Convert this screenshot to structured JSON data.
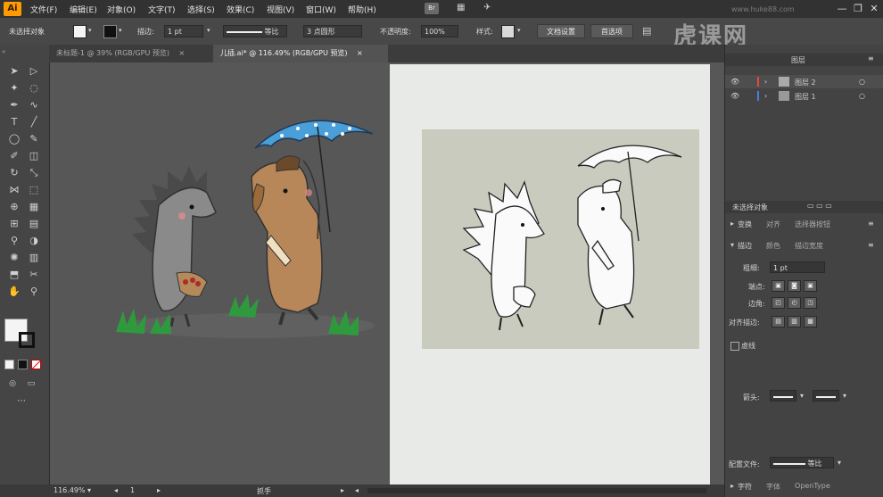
{
  "app": {
    "logo": "Ai"
  },
  "menu": [
    "文件(F)",
    "编辑(E)",
    "对象(O)",
    "文字(T)",
    "选择(S)",
    "效果(C)",
    "视图(V)",
    "窗口(W)",
    "帮助(H)"
  ],
  "window_controls": {
    "minimize": "—",
    "restore": "❐",
    "close": "✕"
  },
  "control_bar": {
    "selection": "未选择对象",
    "stroke_label": "描边:",
    "stroke_value": "1 pt",
    "stroke_style": "等比",
    "brush": "3 点圆形",
    "opacity_label": "不透明度:",
    "opacity_value": "100%",
    "style_label": "样式:",
    "doc_settings": "文档设置",
    "preferences": "首选项"
  },
  "tabs": [
    {
      "label": "未标题-1 @ 39% (RGB/GPU 预览)",
      "close": "×"
    },
    {
      "label": "儿插.ai* @ 116.49% (RGB/GPU 预览)",
      "close": "×"
    }
  ],
  "tools": [
    {
      "name": "selection-tool-icon",
      "glyph": "➤"
    },
    {
      "name": "direct-selection-tool-icon",
      "glyph": "▷"
    },
    {
      "name": "magic-wand-icon",
      "glyph": "✦"
    },
    {
      "name": "lasso-icon",
      "glyph": "◌"
    },
    {
      "name": "pen-tool-icon",
      "glyph": "✒"
    },
    {
      "name": "curvature-tool-icon",
      "glyph": "∿"
    },
    {
      "name": "type-tool-icon",
      "glyph": "T"
    },
    {
      "name": "line-tool-icon",
      "glyph": "╱"
    },
    {
      "name": "ellipse-tool-icon",
      "glyph": "◯"
    },
    {
      "name": "paintbrush-icon",
      "glyph": "✎"
    },
    {
      "name": "shaper-tool-icon",
      "glyph": "✐"
    },
    {
      "name": "eraser-icon",
      "glyph": "◫"
    },
    {
      "name": "rotate-tool-icon",
      "glyph": "↻"
    },
    {
      "name": "scale-tool-icon",
      "glyph": "⤡"
    },
    {
      "name": "width-tool-icon",
      "glyph": "⋈"
    },
    {
      "name": "free-transform-icon",
      "glyph": "⬚"
    },
    {
      "name": "shape-builder-icon",
      "glyph": "⊕"
    },
    {
      "name": "perspective-grid-icon",
      "glyph": "▦"
    },
    {
      "name": "mesh-tool-icon",
      "glyph": "⊞"
    },
    {
      "name": "gradient-tool-icon",
      "glyph": "▤"
    },
    {
      "name": "eyedropper-icon",
      "glyph": "⚲"
    },
    {
      "name": "blend-tool-icon",
      "glyph": "◑"
    },
    {
      "name": "symbol-sprayer-icon",
      "glyph": "✺"
    },
    {
      "name": "column-graph-icon",
      "glyph": "▥"
    },
    {
      "name": "artboard-tool-icon",
      "glyph": "⬒"
    },
    {
      "name": "slice-tool-icon",
      "glyph": "✂"
    },
    {
      "name": "hand-tool-icon",
      "glyph": "✋"
    },
    {
      "name": "zoom-tool-icon",
      "glyph": "⚲"
    }
  ],
  "colors": {
    "fill": "#f4f4f4",
    "stroke": "#000000",
    "umbrella": "#4a9fd8",
    "hedgehog": "#7a7a7a",
    "dog": "#b7875a",
    "grass": "#2f9a3d",
    "highlight": "#ff9a00"
  },
  "layers_panel": {
    "title": "图层",
    "layers": [
      {
        "name": "图层 2",
        "color": "#e84545"
      },
      {
        "name": "图层 1",
        "color": "#4a7fd8"
      }
    ]
  },
  "properties_panel": {
    "no_selection": "未选择对象",
    "transform": "变换",
    "transform_opts": [
      "对齐",
      "选择器按钮"
    ],
    "stroke_section": "描边",
    "stroke_opts": [
      "颜色",
      "描边宽度"
    ],
    "weight_label": "粗细:",
    "weight_value": "1 pt",
    "cap_label": "端点:",
    "corner_label": "边角:",
    "align_stroke_label": "对齐描边:",
    "dashed_label": "虚线",
    "arrow_label": "箭头:",
    "profile_label": "配置文件:",
    "profile_value": "等比",
    "char_label": "字符",
    "font_label": "字体",
    "font_value": "OpenType"
  },
  "status": {
    "zoom": "116.49%",
    "artboard": "1",
    "tool": "抓手"
  },
  "watermark": {
    "text": "虎课网",
    "sub": "www.huke88.com"
  }
}
